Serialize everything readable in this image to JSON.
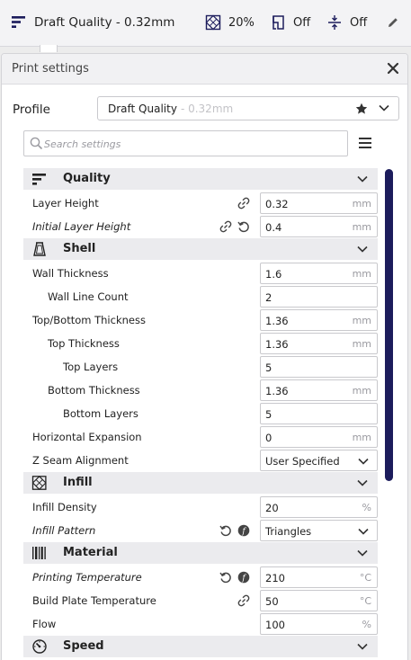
{
  "topbar": {
    "profile_label": "Draft Quality - 0.32mm",
    "infill_value": "20%",
    "support_value": "Off",
    "adhesion_value": "Off"
  },
  "panel": {
    "title": "Print settings",
    "profile_label": "Profile",
    "profile_name": "Draft Quality",
    "profile_suffix": "- 0.32mm",
    "search_placeholder": "Search settings"
  },
  "categories": {
    "quality": "Quality",
    "shell": "Shell",
    "infill": "Infill",
    "material": "Material",
    "speed": "Speed"
  },
  "settings": {
    "layer_height": {
      "label": "Layer Height",
      "value": "0.32",
      "unit": "mm"
    },
    "initial_layer_height": {
      "label": "Initial Layer Height",
      "value": "0.4",
      "unit": "mm"
    },
    "wall_thickness": {
      "label": "Wall Thickness",
      "value": "1.6",
      "unit": "mm"
    },
    "wall_line_count": {
      "label": "Wall Line Count",
      "value": "2"
    },
    "top_bottom_thickness": {
      "label": "Top/Bottom Thickness",
      "value": "1.36",
      "unit": "mm"
    },
    "top_thickness": {
      "label": "Top Thickness",
      "value": "1.36",
      "unit": "mm"
    },
    "top_layers": {
      "label": "Top Layers",
      "value": "5"
    },
    "bottom_thickness": {
      "label": "Bottom Thickness",
      "value": "1.36",
      "unit": "mm"
    },
    "bottom_layers": {
      "label": "Bottom Layers",
      "value": "5"
    },
    "horizontal_expansion": {
      "label": "Horizontal Expansion",
      "value": "0",
      "unit": "mm"
    },
    "z_seam_alignment": {
      "label": "Z Seam Alignment",
      "value": "User Specified"
    },
    "infill_density": {
      "label": "Infill Density",
      "value": "20",
      "unit": "%"
    },
    "infill_pattern": {
      "label": "Infill Pattern",
      "value": "Triangles"
    },
    "printing_temperature": {
      "label": "Printing Temperature",
      "value": "210",
      "unit": "°C"
    },
    "build_plate_temperature": {
      "label": "Build Plate Temperature",
      "value": "50",
      "unit": "°C"
    },
    "flow": {
      "label": "Flow",
      "value": "100",
      "unit": "%"
    }
  },
  "colors": {
    "accent": "#1c1c5c",
    "category_bg": "#ebebee"
  }
}
